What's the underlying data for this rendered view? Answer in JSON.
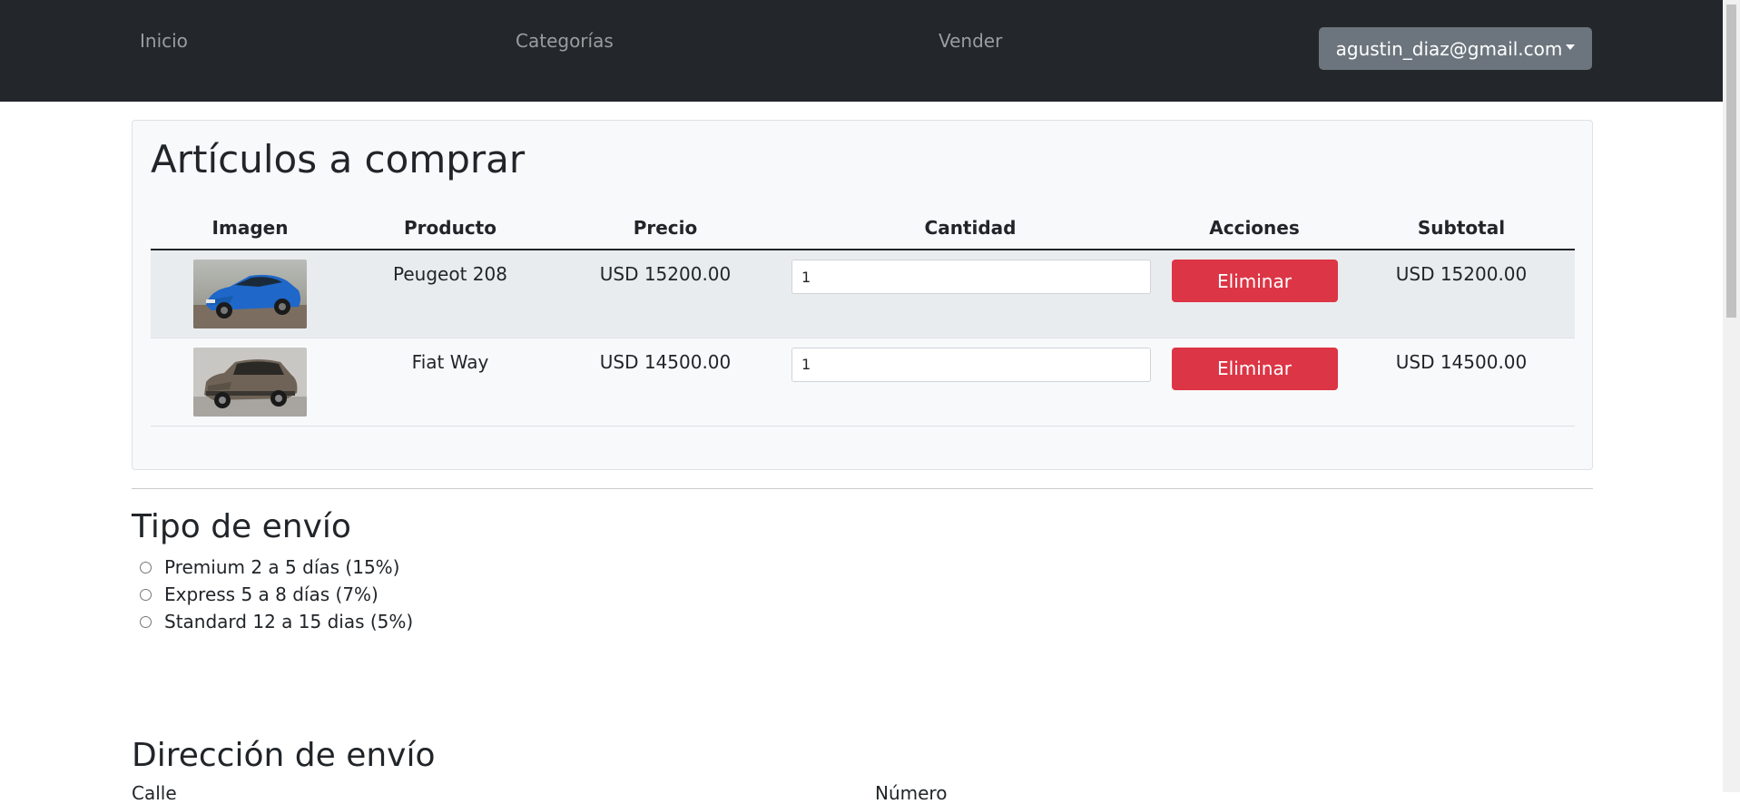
{
  "navbar": {
    "links": [
      "Inicio",
      "Categorías",
      "Vender"
    ],
    "user_email": "agustin_diaz@gmail.com"
  },
  "cart": {
    "title": "Artículos a comprar",
    "columns": [
      "Imagen",
      "Producto",
      "Precio",
      "Cantidad",
      "Acciones",
      "Subtotal"
    ],
    "rows": [
      {
        "image_icon": "blue-car-photo",
        "product": "Peugeot 208",
        "price": "USD 15200.00",
        "quantity": "1",
        "action_label": "Eliminar",
        "subtotal": "USD 15200.00"
      },
      {
        "image_icon": "brown-suv-photo",
        "product": "Fiat Way",
        "price": "USD 14500.00",
        "quantity": "1",
        "action_label": "Eliminar",
        "subtotal": "USD 14500.00"
      }
    ]
  },
  "shipping": {
    "title": "Tipo de envío",
    "options": [
      "Premium 2 a 5 días (15%)",
      "Express 5 a 8 días (7%)",
      "Standard 12 a 15 dias (5%)"
    ]
  },
  "address": {
    "title": "Dirección de envío",
    "field_labels_partial": [
      "Calle",
      "Número"
    ]
  },
  "colors": {
    "navbar_bg": "#23272b",
    "danger": "#dc3545",
    "secondary": "#6c757d"
  }
}
